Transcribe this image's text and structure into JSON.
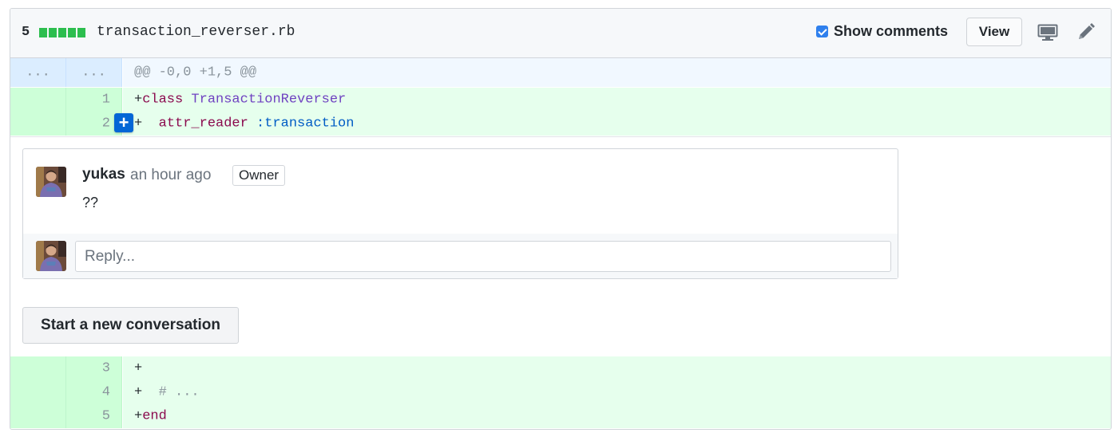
{
  "file": {
    "diffstat_count": "5",
    "diffstat_blocks": 5,
    "name": "transaction_reverser.rb"
  },
  "header": {
    "show_comments_checked": true,
    "show_comments_label": "Show comments",
    "view_label": "View",
    "icons": [
      "desktop-icon",
      "pencil-icon"
    ]
  },
  "hunk": {
    "old_marker": "...",
    "new_marker": "...",
    "header": "@@ -0,0 +1,5 @@"
  },
  "lines_top": [
    {
      "num": "1",
      "tokens": [
        [
          "+",
          ""
        ],
        [
          "class",
          "k-kw"
        ],
        [
          " ",
          ""
        ],
        [
          "TransactionReverser",
          "k-cls"
        ]
      ]
    },
    {
      "num": "2",
      "tokens": [
        [
          "+  ",
          ""
        ],
        [
          "attr_reader",
          "k-kw"
        ],
        [
          " ",
          ""
        ],
        [
          ":transaction",
          "k-sym"
        ]
      ]
    }
  ],
  "add_line_button": "+",
  "comment": {
    "author": "yukas",
    "time": "an hour ago",
    "badge": "Owner",
    "body": "??"
  },
  "reply": {
    "placeholder": "Reply..."
  },
  "new_conversation_label": "Start a new conversation",
  "lines_bottom": [
    {
      "num": "3",
      "tokens": [
        [
          "+",
          ""
        ]
      ]
    },
    {
      "num": "4",
      "tokens": [
        [
          "+  ",
          ""
        ],
        [
          "# ...",
          "k-com"
        ]
      ]
    },
    {
      "num": "5",
      "tokens": [
        [
          "+",
          ""
        ],
        [
          "end",
          "k-kw"
        ]
      ]
    }
  ],
  "colors": {
    "addition_bg": "#e6ffed",
    "addition_num_bg": "#cdffd8",
    "hunk_bg": "#f1f8ff",
    "diffstat_green": "#2cbe4e",
    "primary_blue": "#0366d6"
  }
}
